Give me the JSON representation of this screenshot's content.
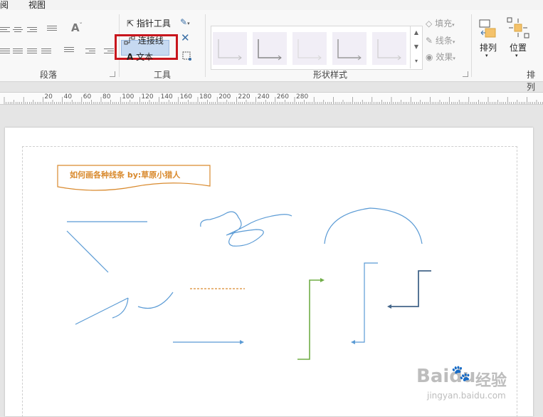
{
  "menubar": {
    "item_view": "视图",
    "item_partial": "阅"
  },
  "ribbon": {
    "groups": {
      "paragraph": "段落",
      "tools": "工具",
      "shape_styles": "形状样式",
      "arrange_partial": "排列"
    },
    "tools": {
      "pointer": "指针工具",
      "connector": "连接线",
      "text": "文本"
    },
    "format": {
      "fill": "填充",
      "line": "线条",
      "effect": "效果"
    },
    "arrange": {
      "arrange": "排列",
      "position": "位置"
    }
  },
  "ruler": {
    "labels": [
      "20",
      "40",
      "60",
      "80",
      "100",
      "120",
      "140",
      "160",
      "180",
      "200",
      "220",
      "240",
      "260",
      "280"
    ]
  },
  "canvas": {
    "title": "如何画各种线条    by:草原小猎人"
  },
  "watermark": {
    "brand": "Baidu",
    "brand_cn": "经验",
    "url": "jingyan.baidu.com"
  },
  "colors": {
    "highlight": "#c8161d",
    "line_blue": "#5b9bd5",
    "line_green": "#70ad47",
    "line_darkblue": "#44668a",
    "line_orange": "#d98a2e"
  }
}
